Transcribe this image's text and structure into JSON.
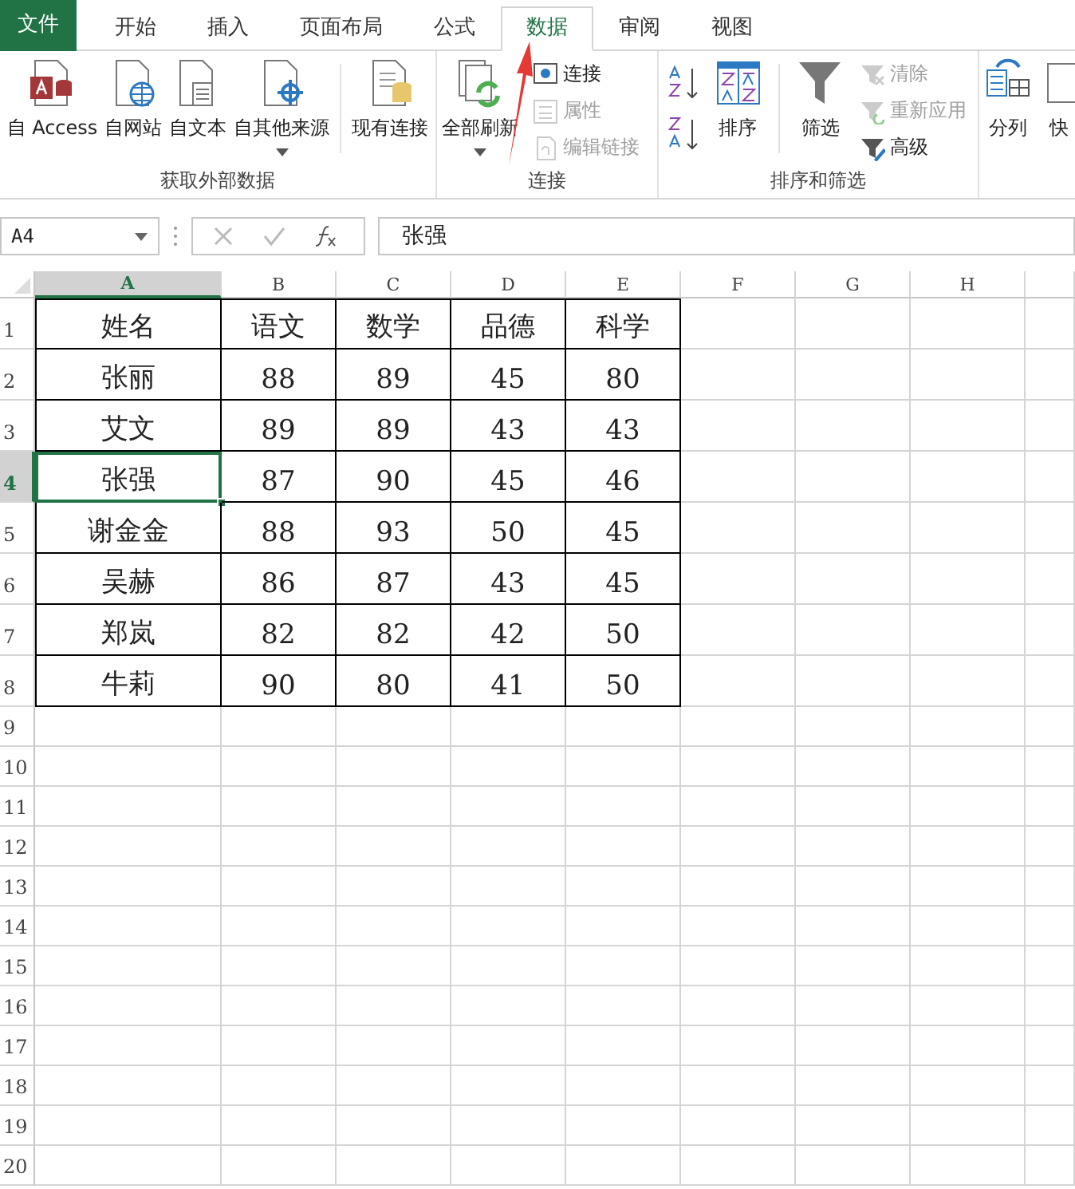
{
  "tabs": [
    {
      "label": "文件",
      "kind": "file",
      "selected": false
    },
    {
      "label": "开始",
      "kind": "tab",
      "selected": false
    },
    {
      "label": "插入",
      "kind": "tab",
      "selected": false
    },
    {
      "label": "页面布局",
      "kind": "tab",
      "selected": false
    },
    {
      "label": "公式",
      "kind": "tab",
      "selected": false
    },
    {
      "label": "数据",
      "kind": "tab",
      "selected": true
    },
    {
      "label": "审阅",
      "kind": "tab",
      "selected": false
    },
    {
      "label": "视图",
      "kind": "tab",
      "selected": false
    }
  ],
  "ribbon_groups": [
    {
      "label": "获取外部数据",
      "items": [
        {
          "kind": "large",
          "label": "自 Access",
          "disabled": false
        },
        {
          "kind": "large",
          "label": "自网站",
          "disabled": false
        },
        {
          "kind": "large",
          "label": "自文本",
          "disabled": false
        },
        {
          "kind": "large",
          "label": "自其他来源",
          "disabled": false,
          "dropdown": true
        },
        {
          "kind": "divider"
        },
        {
          "kind": "large",
          "label": "现有连接",
          "disabled": false
        }
      ]
    },
    {
      "label": "连接",
      "items": [
        {
          "kind": "large",
          "label": "全部刷新",
          "disabled": false,
          "dropdown": true
        },
        {
          "kind": "stack",
          "items": [
            {
              "label": "连接",
              "disabled": false
            },
            {
              "label": "属性",
              "disabled": true
            },
            {
              "label": "编辑链接",
              "disabled": true
            }
          ]
        }
      ]
    },
    {
      "label": "排序和筛选",
      "items": [
        {
          "kind": "sorts"
        },
        {
          "kind": "large",
          "label": "排序",
          "disabled": false
        },
        {
          "kind": "divider"
        },
        {
          "kind": "large",
          "label": "筛选",
          "disabled": false
        },
        {
          "kind": "stack",
          "items": [
            {
              "label": "清除",
              "disabled": true
            },
            {
              "label": "重新应用",
              "disabled": true
            },
            {
              "label": "高级",
              "disabled": false
            }
          ]
        }
      ]
    },
    {
      "items": [
        {
          "kind": "large",
          "label": "分列",
          "disabled": false
        },
        {
          "kind": "large",
          "label": "快",
          "disabled": false
        }
      ]
    }
  ],
  "name_box": "A4",
  "formula": "张强",
  "columns": [
    {
      "label": "A",
      "selected": true
    },
    {
      "label": "B",
      "selected": false
    },
    {
      "label": "C",
      "selected": false
    },
    {
      "label": "D",
      "selected": false
    },
    {
      "label": "E",
      "selected": false
    },
    {
      "label": "F",
      "selected": false
    },
    {
      "label": "G",
      "selected": false
    },
    {
      "label": "H",
      "selected": false
    }
  ],
  "rows": [
    {
      "header": "1",
      "selected": false,
      "cells": [
        {
          "value": "姓名",
          "selected": false
        },
        {
          "value": "语文",
          "selected": false
        },
        {
          "value": "数学",
          "selected": false
        },
        {
          "value": "品德",
          "selected": false
        },
        {
          "value": "科学",
          "selected": false
        }
      ]
    },
    {
      "header": "2",
      "selected": false,
      "cells": [
        {
          "value": "张丽",
          "selected": false
        },
        {
          "value": "88",
          "selected": false
        },
        {
          "value": "89",
          "selected": false
        },
        {
          "value": "45",
          "selected": false
        },
        {
          "value": "80",
          "selected": false
        }
      ]
    },
    {
      "header": "3",
      "selected": false,
      "cells": [
        {
          "value": "艾文",
          "selected": false
        },
        {
          "value": "89",
          "selected": false
        },
        {
          "value": "89",
          "selected": false
        },
        {
          "value": "43",
          "selected": false
        },
        {
          "value": "43",
          "selected": false
        }
      ]
    },
    {
      "header": "4",
      "selected": true,
      "cells": [
        {
          "value": "张强",
          "selected": true
        },
        {
          "value": "87",
          "selected": false
        },
        {
          "value": "90",
          "selected": false
        },
        {
          "value": "45",
          "selected": false
        },
        {
          "value": "46",
          "selected": false
        }
      ]
    },
    {
      "header": "5",
      "selected": false,
      "cells": [
        {
          "value": "谢金金",
          "selected": false
        },
        {
          "value": "88",
          "selected": false
        },
        {
          "value": "93",
          "selected": false
        },
        {
          "value": "50",
          "selected": false
        },
        {
          "value": "45",
          "selected": false
        }
      ]
    },
    {
      "header": "6",
      "selected": false,
      "cells": [
        {
          "value": "吴赫",
          "selected": false
        },
        {
          "value": "86",
          "selected": false
        },
        {
          "value": "87",
          "selected": false
        },
        {
          "value": "43",
          "selected": false
        },
        {
          "value": "45",
          "selected": false
        }
      ]
    },
    {
      "header": "7",
      "selected": false,
      "cells": [
        {
          "value": "郑岚",
          "selected": false
        },
        {
          "value": "82",
          "selected": false
        },
        {
          "value": "82",
          "selected": false
        },
        {
          "value": "42",
          "selected": false
        },
        {
          "value": "50",
          "selected": false
        }
      ]
    },
    {
      "header": "8",
      "selected": false,
      "cells": [
        {
          "value": "牛莉",
          "selected": false
        },
        {
          "value": "90",
          "selected": false
        },
        {
          "value": "80",
          "selected": false
        },
        {
          "value": "41",
          "selected": false
        },
        {
          "value": "50",
          "selected": false
        }
      ]
    },
    {
      "header": "9",
      "selected": false,
      "cells": []
    },
    {
      "header": "10",
      "selected": false,
      "cells": []
    },
    {
      "header": "11",
      "selected": false,
      "cells": []
    },
    {
      "header": "12",
      "selected": false,
      "cells": []
    },
    {
      "header": "13",
      "selected": false,
      "cells": []
    },
    {
      "header": "14",
      "selected": false,
      "cells": []
    },
    {
      "header": "15",
      "selected": false,
      "cells": []
    },
    {
      "header": "16",
      "selected": false,
      "cells": []
    },
    {
      "header": "17",
      "selected": false,
      "cells": []
    },
    {
      "header": "18",
      "selected": false,
      "cells": []
    },
    {
      "header": "19",
      "selected": false,
      "cells": []
    },
    {
      "header": "20",
      "selected": false,
      "cells": []
    }
  ]
}
